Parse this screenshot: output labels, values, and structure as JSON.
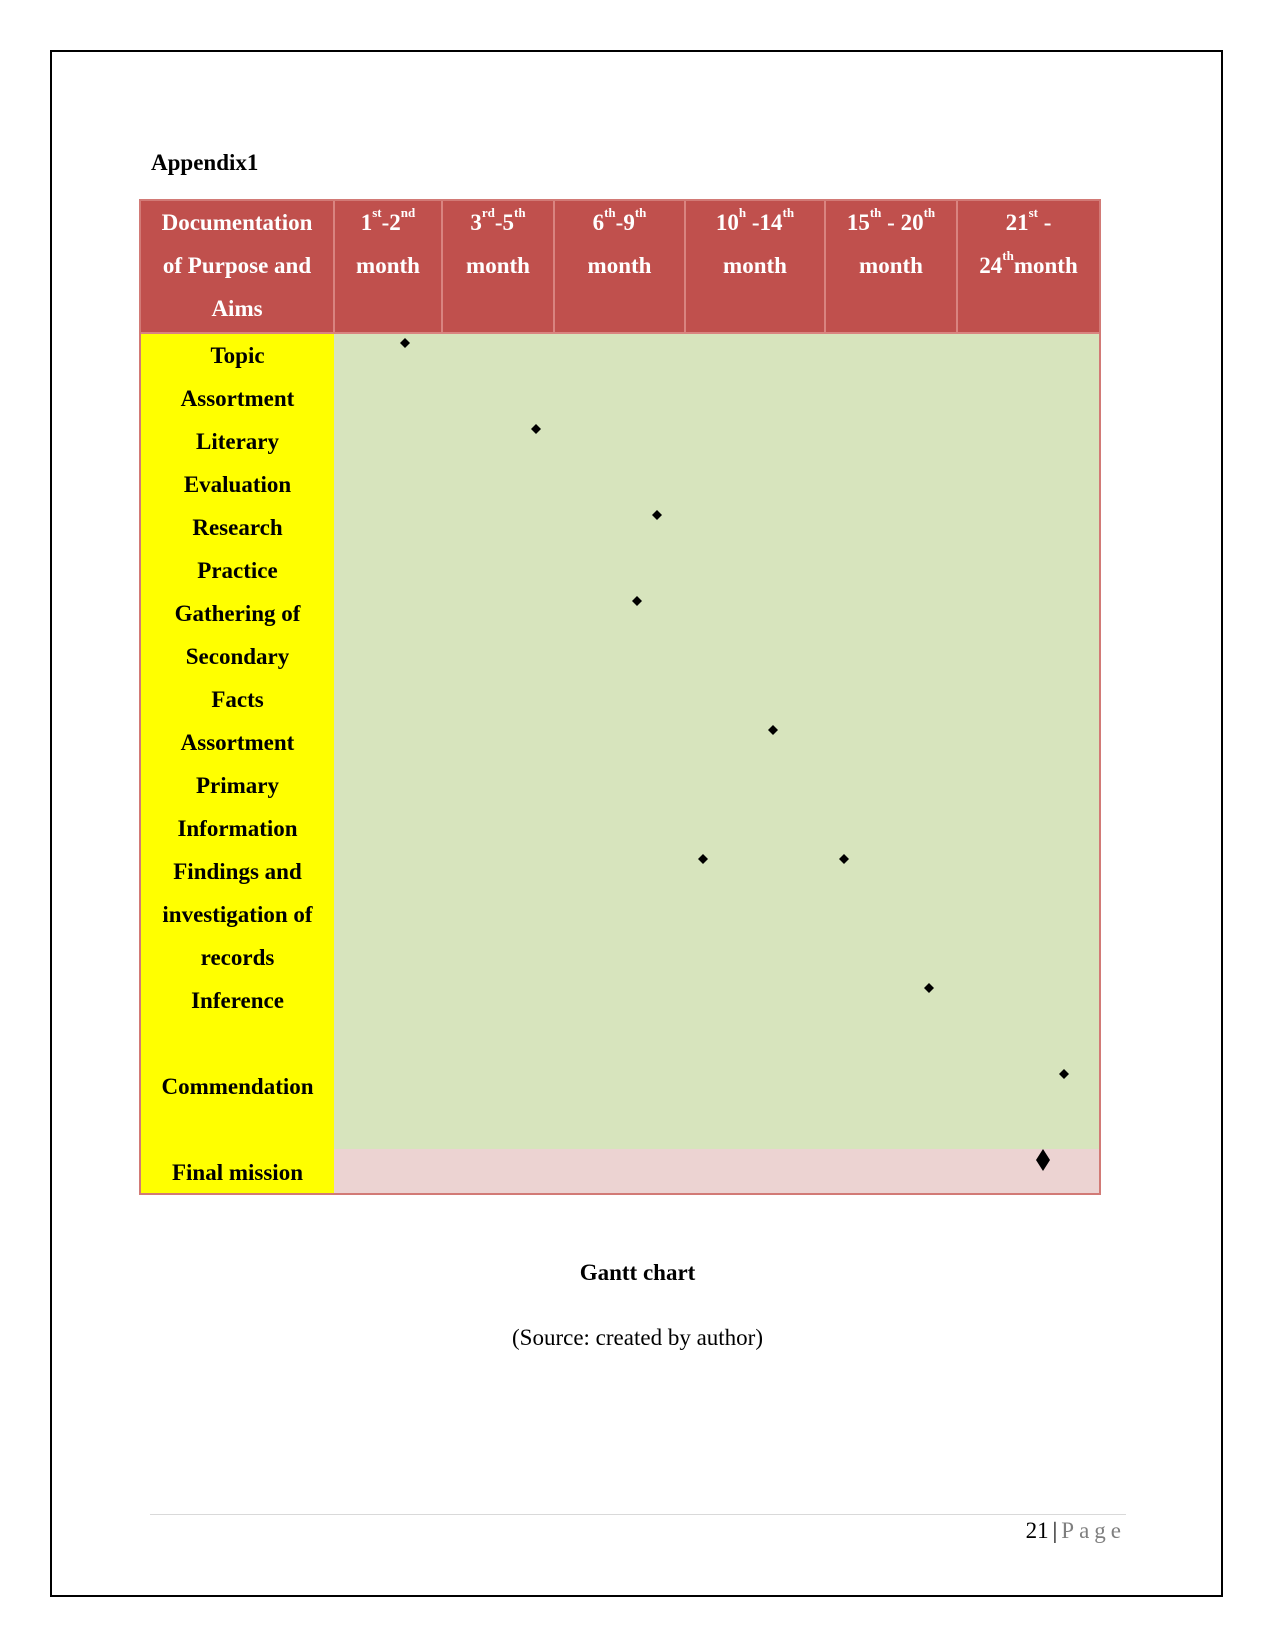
{
  "document": {
    "appendix_title": "Appendix1",
    "caption_title": "Gantt chart",
    "caption_source": "(Source: created by author)",
    "footer": {
      "page_number": "21",
      "separator": "|",
      "page_word": "Page"
    }
  },
  "colors": {
    "header_bg": "#c0504d",
    "header_text": "#ffffff",
    "label_bg": "#ffff00",
    "body_bg": "#d7e4bd",
    "final_row_bg": "#ecd3d2",
    "table_border": "#d27a76",
    "milestone": "#000000"
  },
  "chart_data": {
    "type": "table",
    "title": "Gantt chart",
    "subtitle": "(Source: created by author)",
    "header_first": [
      "Documentation",
      "of Purpose and",
      "Aims"
    ],
    "periods": [
      {
        "start": 1,
        "end": 2,
        "line1": [
          [
            "1",
            ""
          ],
          [
            "st",
            true
          ],
          [
            "-2",
            ""
          ],
          [
            "nd",
            true
          ]
        ],
        "line2": "month"
      },
      {
        "start": 3,
        "end": 5,
        "line1": [
          [
            "3",
            ""
          ],
          [
            "rd",
            true
          ],
          [
            "-5",
            ""
          ],
          [
            "th",
            true
          ]
        ],
        "line2": "month"
      },
      {
        "start": 6,
        "end": 9,
        "line1": [
          [
            "6",
            ""
          ],
          [
            "th",
            true
          ],
          [
            "-9",
            ""
          ],
          [
            "th",
            true
          ]
        ],
        "line2": "month"
      },
      {
        "start": 10,
        "end": 14,
        "line1": [
          [
            "10",
            ""
          ],
          [
            "h",
            true
          ],
          [
            " -14",
            ""
          ],
          [
            "th",
            true
          ]
        ],
        "line2": "month"
      },
      {
        "start": 15,
        "end": 20,
        "line1": [
          [
            "15",
            ""
          ],
          [
            "th",
            true
          ],
          [
            " - 20",
            ""
          ],
          [
            "th",
            true
          ]
        ],
        "line2": "month"
      },
      {
        "start": 21,
        "end": 24,
        "line1": [
          [
            "21",
            ""
          ],
          [
            "st",
            true
          ],
          [
            " -",
            ""
          ]
        ],
        "line2": [
          [
            "24",
            ""
          ],
          [
            "th",
            true
          ],
          [
            "month",
            ""
          ]
        ]
      }
    ],
    "tasks": [
      {
        "name": "Topic Assortment",
        "lines": [
          "Topic",
          "Assortment"
        ],
        "milestones": [
          1.3
        ]
      },
      {
        "name": "Literary Evaluation",
        "lines": [
          "Literary",
          "Evaluation"
        ],
        "milestones": [
          4.5
        ]
      },
      {
        "name": "Research Practice",
        "lines": [
          "Research",
          "Practice"
        ],
        "milestones": [
          8.1
        ]
      },
      {
        "name": "Gathering of Secondary Facts",
        "lines": [
          "Gathering of",
          "Secondary",
          "Facts"
        ],
        "milestones": [
          7.5
        ]
      },
      {
        "name": "Assortment Primary Information",
        "lines": [
          "Assortment",
          "Primary",
          "Information"
        ],
        "milestones": [
          12.1
        ]
      },
      {
        "name": "Findings and investigation of records",
        "lines": [
          "Findings and",
          "investigation of",
          "records"
        ],
        "milestones": [
          9.6,
          14.8
        ]
      },
      {
        "name": "Inference",
        "lines": [
          "Inference",
          ""
        ],
        "milestones": [
          18.7
        ]
      },
      {
        "name": "Commendation",
        "lines": [
          "Commendation",
          ""
        ],
        "milestones": [
          23.0
        ]
      },
      {
        "name": "Final mission",
        "lines": [
          "Final mission"
        ],
        "milestones": [
          22.4
        ],
        "final": true
      }
    ],
    "marker": "diamond",
    "xlabel": "Month",
    "xlim": [
      1,
      24
    ]
  }
}
